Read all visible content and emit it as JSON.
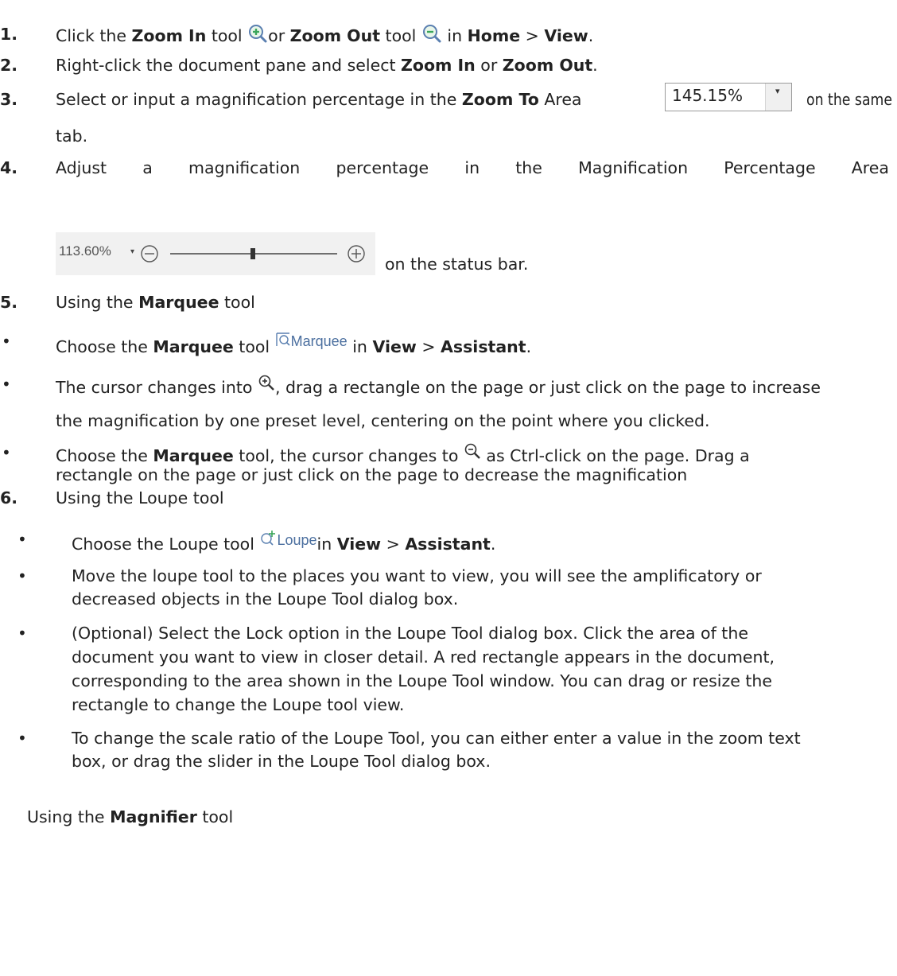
{
  "items": {
    "i1": {
      "num": "1.",
      "t1": "Click the ",
      "b1": "Zoom In",
      "t2": " tool ",
      "t3": "or ",
      "b2": "Zoom Out",
      "t4": " tool ",
      "t5": " in ",
      "b3": "Home",
      "t6": " > ",
      "b4": "View",
      "t7": "."
    },
    "i2": {
      "num": "2.",
      "t1": "Right-click the document pane and select ",
      "b1": "Zoom In",
      "t2": " or ",
      "b2": "Zoom Out",
      "t3": "."
    },
    "i3": {
      "num": "3.",
      "t1": "Select or input a magnification percentage in the ",
      "b1": "Zoom To",
      "t2": " Area",
      "t3": "on the same",
      "t4": "tab."
    },
    "i4": {
      "num": "4.",
      "words": [
        "Adjust",
        "a",
        "magnification",
        "percentage",
        "in",
        "the",
        "Magnification",
        "Percentage",
        "Area"
      ],
      "t_after": "on the status bar."
    },
    "i5": {
      "num": "5.",
      "t1": "Using the ",
      "b1": "Marquee",
      "t2": " tool"
    },
    "b5a": {
      "bullet": "•",
      "t1": "Choose the ",
      "b1": "Marquee",
      "t2": " tool ",
      "t3": "in ",
      "b2": "View",
      "t4": " > ",
      "b3": "Assistant",
      "t5": "."
    },
    "b5b": {
      "bullet": "•",
      "t1": "The cursor changes into ",
      "t2": ", drag a rectangle on the page or just click on the page to increase",
      "t3": "the magnification by one preset level, centering on the point where you clicked."
    },
    "b5c": {
      "bullet": "•",
      "t1": "Choose the ",
      "b1": "Marquee",
      "t2": " tool, the cursor changes to ",
      "t3": " as Ctrl-click on the page. Drag a",
      "t4": "rectangle on the page or just click on the page to decrease the magnification"
    },
    "i6": {
      "num": "6.",
      "t1": "Using the Loupe tool"
    },
    "b6a": {
      "bullet": "•",
      "t1": "Choose the Loupe tool ",
      "t2": "in ",
      "b1": "View",
      "t3": " > ",
      "b2": "Assistant",
      "t4": "."
    },
    "b6b": {
      "bullet": "•",
      "t1": "Move the loupe tool to the places you want to view, you will see the amplificatory or",
      "t2": "decreased objects in the Loupe Tool dialog box."
    },
    "b6c": {
      "bullet": "•",
      "l1": "(Optional) Select the Lock option in the Loupe Tool dialog box. Click the area of the",
      "l2": "document you want to view in closer detail. A red rectangle appears in the document,",
      "l3": "corresponding to the area shown in the Loupe Tool window. You can drag or resize the",
      "l4": "rectangle to change the Loupe tool view."
    },
    "b6d": {
      "bullet": "•",
      "l1": "To change the scale ratio of the Loupe Tool, you can either enter a value in the zoom text",
      "l2": "box, or drag the slider in the Loupe Tool dialog box."
    },
    "magnifier": {
      "t1": "Using the ",
      "b1": "Magnifier",
      "t2": " tool"
    }
  },
  "zoom_to": {
    "value": "145.15%",
    "arrow": "▾"
  },
  "status_bar": {
    "percent": "113.60%",
    "arrow": "▾"
  },
  "labels": {
    "marquee": "Marquee",
    "loupe": "Loupe"
  },
  "icons": {
    "zoom_in": "zoom-in-icon",
    "zoom_out": "zoom-out-icon",
    "minus": "minus-circle-icon",
    "plus": "plus-circle-icon",
    "marquee": "marquee-icon",
    "loupe": "loupe-icon"
  },
  "colors": {
    "icon_blue": "#5a7fb0",
    "icon_green": "#3aa55a",
    "text": "#222222"
  }
}
